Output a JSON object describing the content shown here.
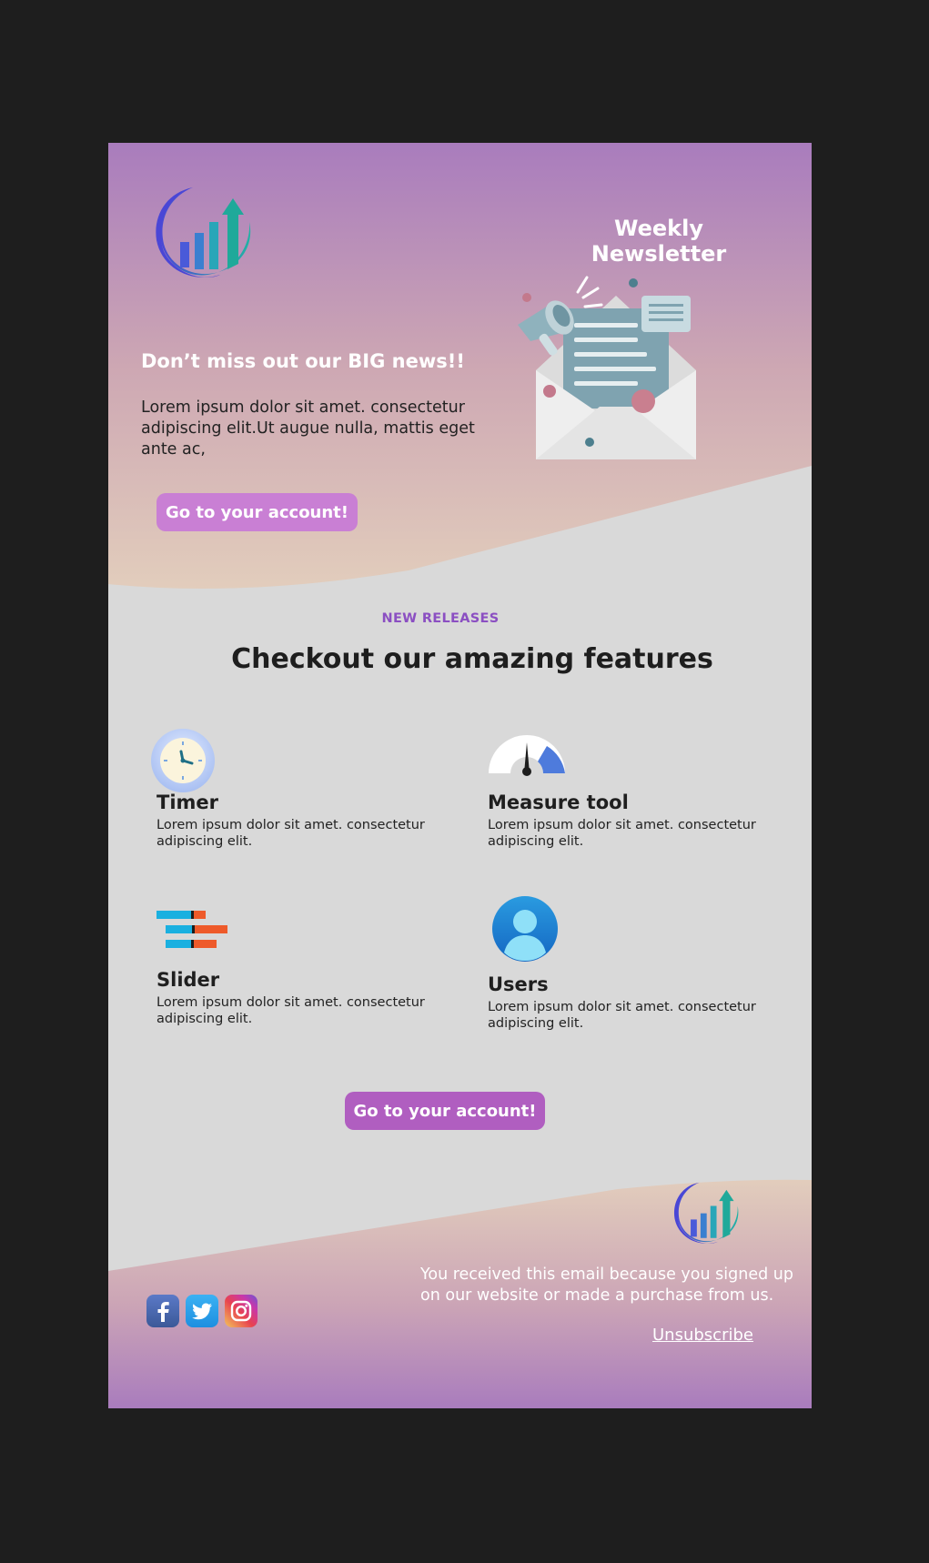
{
  "header": {
    "title": "Weekly Newsletter",
    "logo_icon": "growth-chart-logo-icon",
    "illustration_icon": "envelope-megaphone-illustration"
  },
  "hero": {
    "headline": "Don’t miss  out our BIG news!!",
    "text": "Lorem ipsum dolor sit amet. consectetur adipiscing elit.Ut augue nulla, mattis eget ante ac,",
    "cta_label": "Go to your account!"
  },
  "features_section": {
    "kicker": "NEW RELEASES",
    "title": "Checkout our amazing features",
    "items": [
      {
        "title": "Timer",
        "desc": "Lorem ipsum dolor sit amet. consectetur adipiscing elit.",
        "icon": "clock-icon"
      },
      {
        "title": "Measure tool",
        "desc": "Lorem ipsum dolor sit amet. consectetur adipiscing elit.",
        "icon": "gauge-icon"
      },
      {
        "title": "Slider",
        "desc": "Lorem ipsum dolor sit amet. consectetur adipiscing elit.",
        "icon": "slider-icon"
      },
      {
        "title": "Users",
        "desc": "Lorem ipsum dolor sit amet. consectetur adipiscing elit.",
        "icon": "user-icon"
      }
    ],
    "cta_label": "Go to your account!"
  },
  "footer": {
    "text": "You received this email because you signed up on our website or made a purchase from us.",
    "unsubscribe_label": "Unsubscribe",
    "social": [
      "facebook-icon",
      "twitter-icon",
      "instagram-icon"
    ]
  },
  "colors": {
    "page_background": "#1e1e1e",
    "hero_gradient_top": "#a97cbd",
    "hero_gradient_bottom": "#e2cdbc",
    "content_background": "#d9d9d9",
    "hero_button": "#c97fd4",
    "bottom_button": "#b05ec0",
    "kicker": "#8b4fc2"
  }
}
